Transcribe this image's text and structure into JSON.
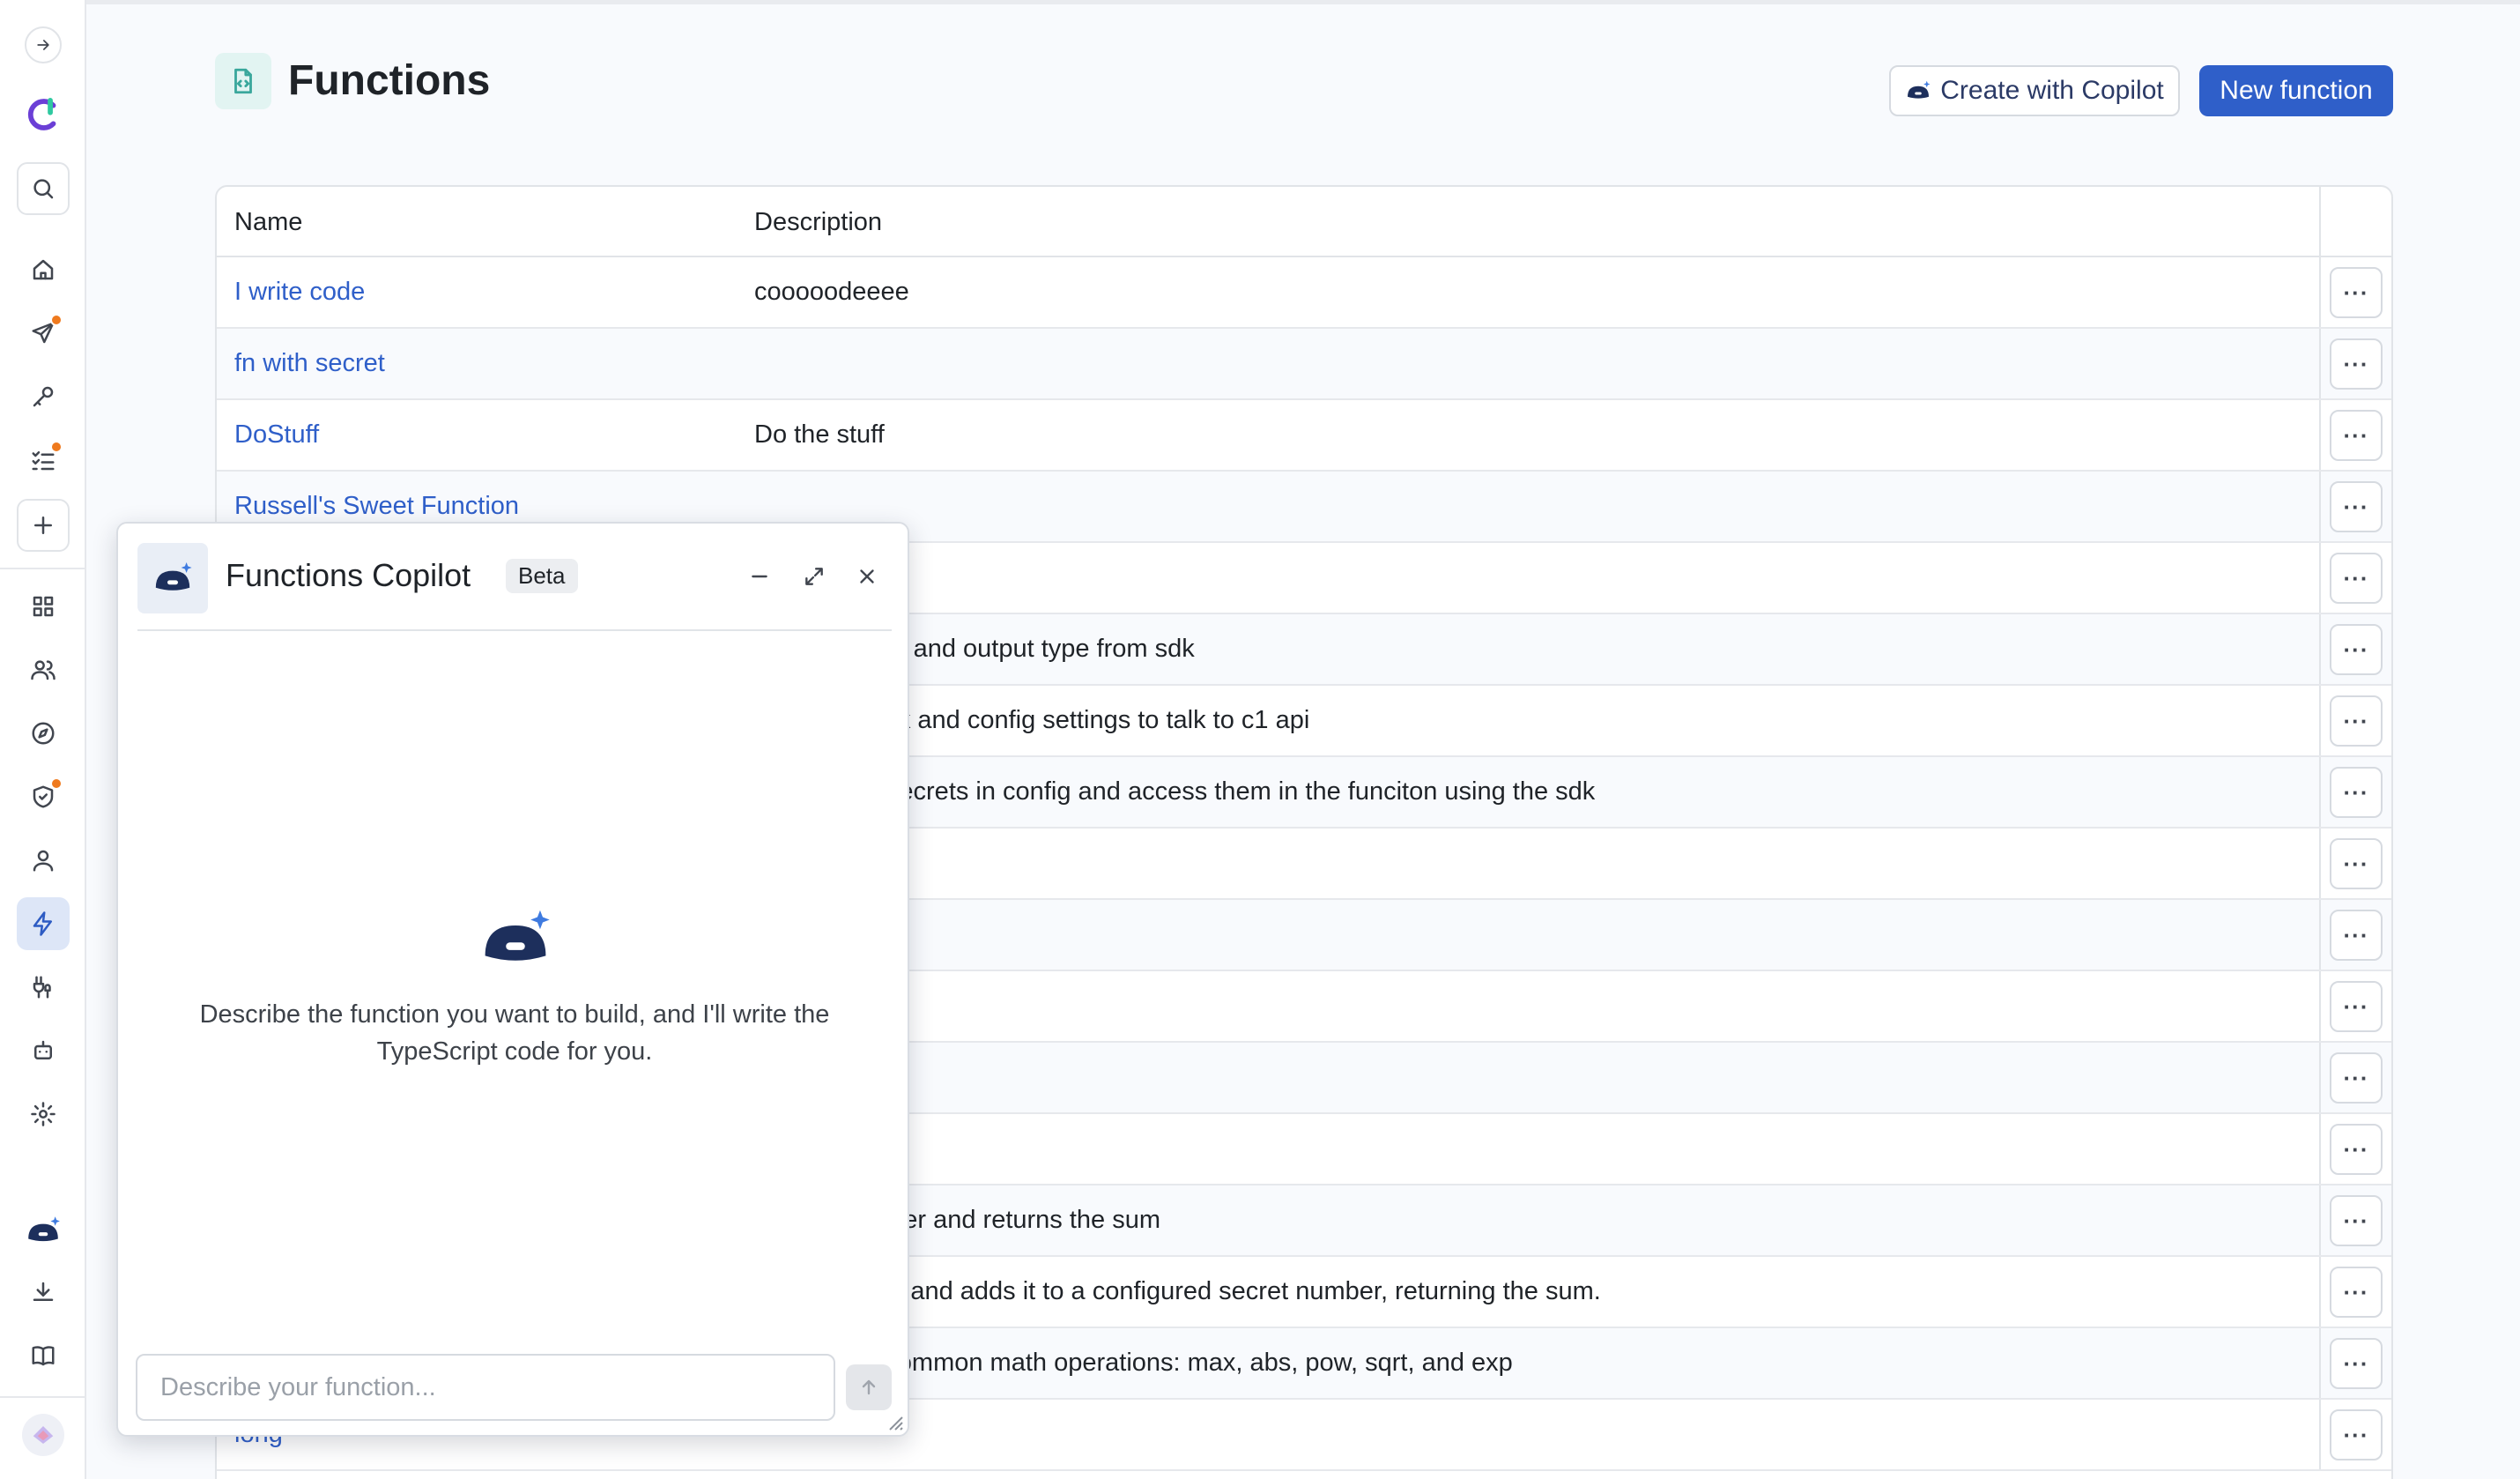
{
  "header": {
    "title": "Functions",
    "create_with_copilot": "Create with Copilot",
    "new_function": "New function"
  },
  "table": {
    "columns": [
      "Name",
      "Description"
    ],
    "rows": [
      {
        "name": "I write code",
        "description": "cooooodeeee"
      },
      {
        "name": "fn with secret",
        "description": ""
      },
      {
        "name": "DoStuff",
        "description": "Do the stuff"
      },
      {
        "name": "Russell's Sweet Function",
        "description": ""
      },
      {
        "name": "",
        "description": ""
      },
      {
        "name": "",
        "description": "sing the input and output type from sdk"
      },
      {
        "name": "",
        "description": "ow to use sdk and config settings to talk to c1 api"
      },
      {
        "name": "",
        "description": "ow to store secrets in config and access them in the funciton using the sdk"
      },
      {
        "name": "",
        "description": ""
      },
      {
        "name": "",
        "description": ""
      },
      {
        "name": "",
        "description": ""
      },
      {
        "name": "",
        "description": ""
      },
      {
        "name": "",
        "description": ""
      },
      {
        "name": "",
        "description": "mbers together and returns the sum"
      },
      {
        "name": "",
        "description": "input number and adds it to a configured secret number, returning the sum."
      },
      {
        "name": "",
        "description": "y providing common math operations: max, abs, pow, sqrt, and exp"
      },
      {
        "name": "long",
        "description": ""
      }
    ]
  },
  "copilot": {
    "title": "Functions Copilot",
    "badge": "Beta",
    "hint": "Describe the function you want to build, and I'll write the TypeScript code for you.",
    "input_placeholder": "Describe your function..."
  },
  "colors": {
    "accent": "#2f5fc9",
    "notification": "#ef7a1e",
    "page_icon": "#3aa79c"
  },
  "icons": {
    "rail": [
      "arrow-right-icon",
      "logo-icon",
      "search-icon",
      "home-icon",
      "send-icon",
      "key-icon",
      "task-list-icon",
      "plus-icon",
      "grid-icon",
      "users-icon",
      "compass-icon",
      "shield-check-icon",
      "user-icon",
      "lightning-icon",
      "connector-icon",
      "bot-icon",
      "settings-icon",
      "copilot-icon",
      "download-icon",
      "book-icon",
      "workspace-icon"
    ]
  }
}
